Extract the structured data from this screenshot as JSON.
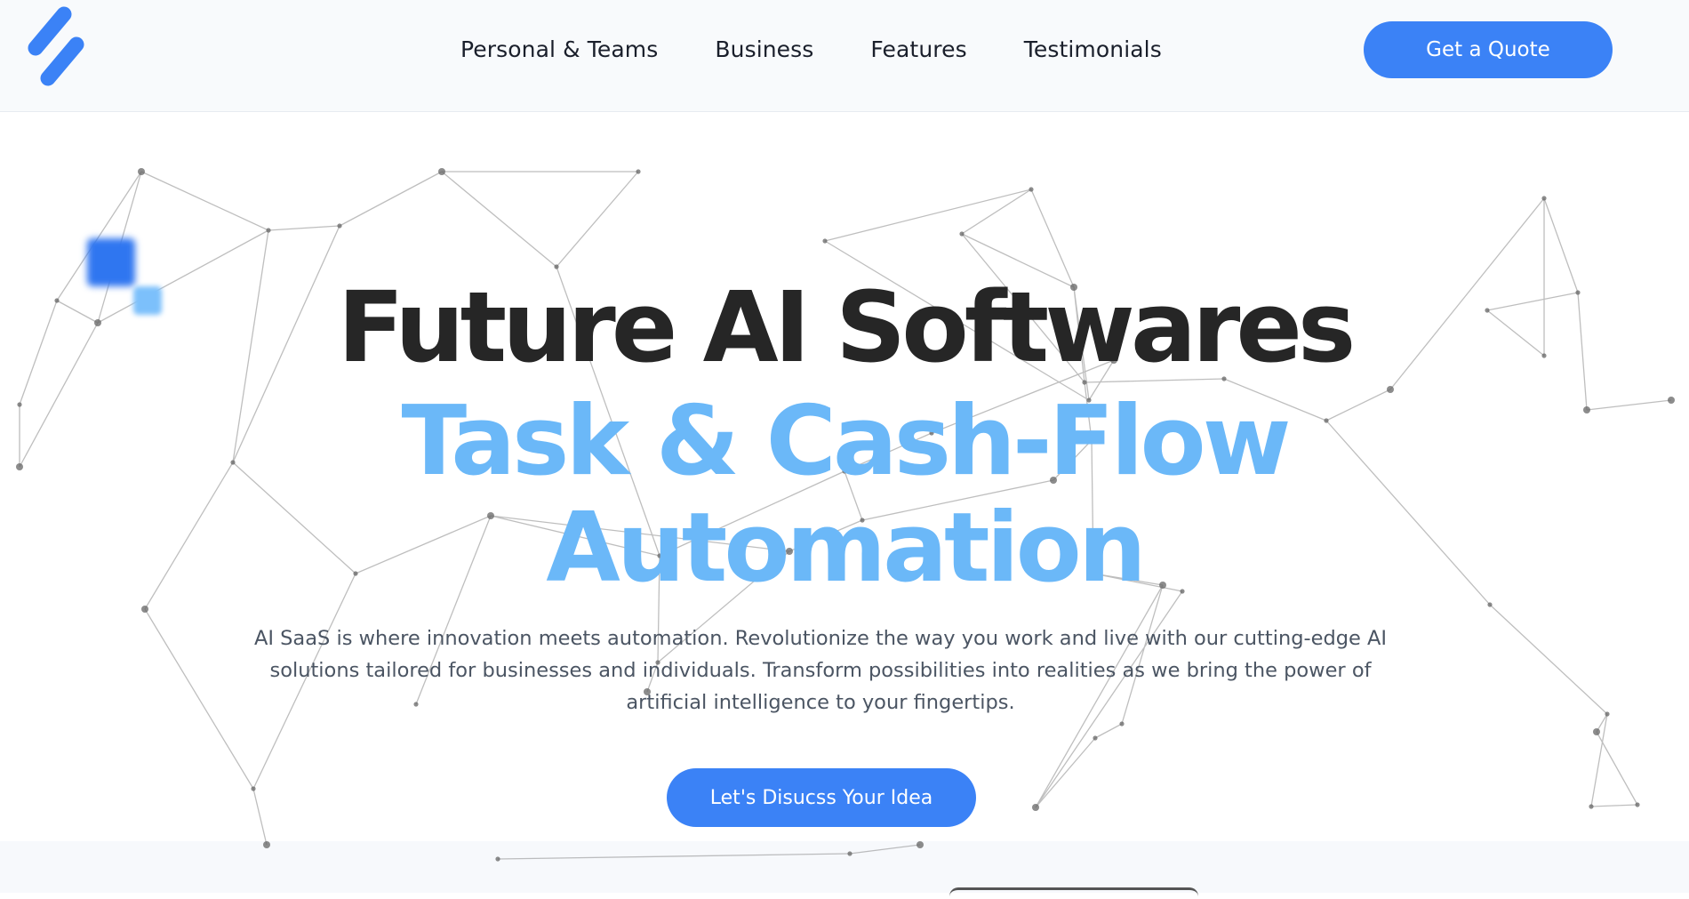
{
  "brand": {
    "accent": "#3b82f6",
    "logo": "logo-mark-icon"
  },
  "nav": {
    "items": [
      {
        "label": "Personal & Teams"
      },
      {
        "label": "Business"
      },
      {
        "label": "Features"
      },
      {
        "label": "Testimonials"
      }
    ],
    "cta_label": "Get a Quote"
  },
  "hero": {
    "title_line1": "Future AI Softwares",
    "title_line2": "Task & Cash-Flow",
    "title_line3": "Automation",
    "description": "AI SaaS is where innovation meets automation. Revolutionize the way you work and live with our cutting-edge AI solutions tailored for businesses and individuals. Transform possibilities into realities as we bring the power of artificial intelligence to your fingertips.",
    "cta_label": "Let's Disucss Your Idea"
  },
  "colors": {
    "title_dark": "#262626",
    "title_blue": "#6bb8f8",
    "text": "#4b5563"
  }
}
